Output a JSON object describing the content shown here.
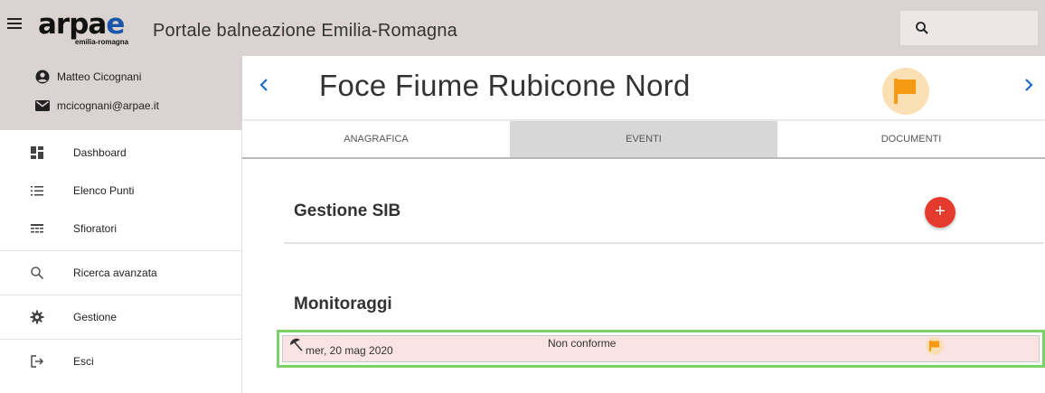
{
  "header": {
    "logo_main": "arpae",
    "logo_sub": "emilia-romagna",
    "app_title": "Portale balneazione Emilia-Romagna",
    "icons": {
      "menu": "hamburger-menu-icon",
      "search": "search-icon"
    }
  },
  "user": {
    "name": "Matteo Cicognani",
    "email": "mcicognani@arpae.it"
  },
  "sidebar": {
    "items": [
      {
        "label": "Dashboard",
        "icon": "dashboard-icon"
      },
      {
        "label": "Elenco Punti",
        "icon": "list-icon"
      },
      {
        "label": "Sfioratori",
        "icon": "table-icon"
      },
      {
        "label": "Ricerca avanzata",
        "icon": "search-icon"
      },
      {
        "label": "Gestione",
        "icon": "gear-icon"
      },
      {
        "label": "Esci",
        "icon": "logout-icon"
      }
    ]
  },
  "point": {
    "title": "Foce Fiume Rubicone Nord",
    "status_icon": "flag-icon",
    "status_color": "#f59a12"
  },
  "tabs": [
    {
      "label": "ANAGRAFICA",
      "active": false
    },
    {
      "label": "EVENTI",
      "active": true
    },
    {
      "label": "DOCUMENTI",
      "active": false
    }
  ],
  "sections": {
    "sib_title": "Gestione SIB",
    "add_label": "+",
    "monitor_title": "Monitoraggi"
  },
  "monitoraggi": [
    {
      "date": "mer, 20 mag 2020",
      "status": "Non conforme",
      "flag_color": "#f59a12"
    }
  ],
  "colors": {
    "topbar": "#dbd3d1",
    "accent_blue": "#1a6cc8",
    "add_button": "#e53b2e",
    "row_highlight": "#7ad36a",
    "row_bg": "#fae3e3"
  }
}
